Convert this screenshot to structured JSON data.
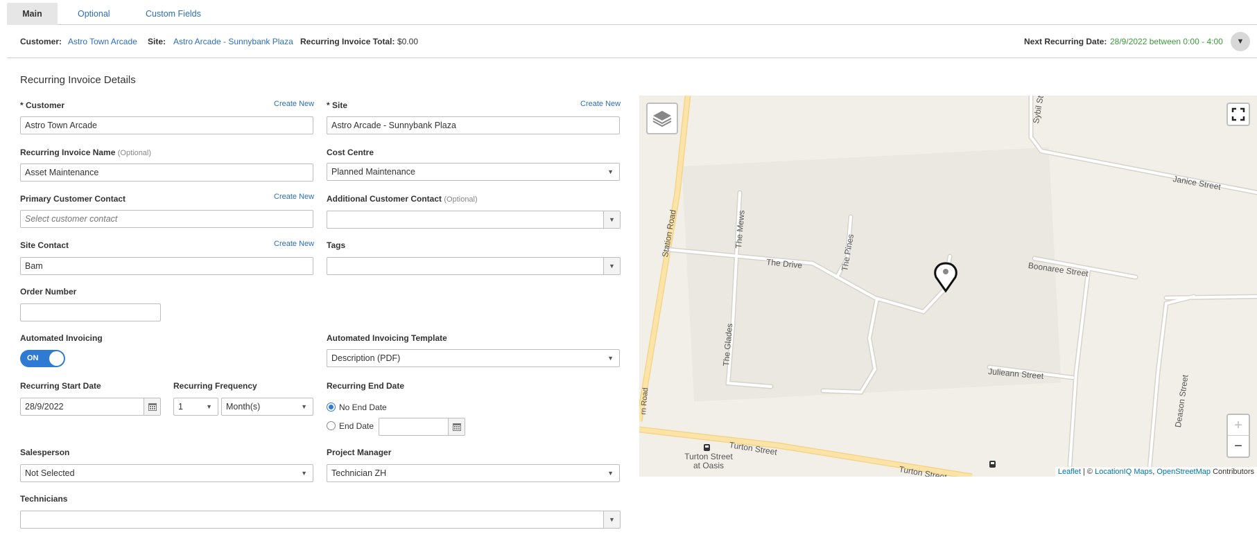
{
  "tabs": [
    "Main",
    "Optional",
    "Custom Fields"
  ],
  "summary": {
    "customer_label": "Customer:",
    "customer_value": "Astro Town Arcade",
    "site_label": "Site:",
    "site_value": "Astro Arcade - Sunnybank Plaza",
    "total_label": "Recurring Invoice Total:",
    "total_value": "$0.00",
    "next_label": "Next Recurring Date:",
    "next_value": "28/9/2022 between 0:00 - 4:00",
    "collapse_icon": "chevron-down-icon"
  },
  "section_title": "Recurring Invoice Details",
  "create_new": "Create New",
  "fields": {
    "customer": {
      "label": "* Customer",
      "value": "Astro Town Arcade"
    },
    "site": {
      "label": "* Site",
      "value": "Astro Arcade - Sunnybank Plaza"
    },
    "invoice_name": {
      "label": "Recurring Invoice Name",
      "optional": "(Optional)",
      "value": "Asset Maintenance"
    },
    "cost_centre": {
      "label": "Cost Centre",
      "value": "Planned Maintenance"
    },
    "primary_contact": {
      "label": "Primary Customer Contact",
      "placeholder": "Select customer contact"
    },
    "additional_contact": {
      "label": "Additional Customer Contact",
      "optional": "(Optional)",
      "value": ""
    },
    "site_contact": {
      "label": "Site Contact",
      "value": "Bam"
    },
    "tags": {
      "label": "Tags",
      "value": ""
    },
    "order_number": {
      "label": "Order Number",
      "value": ""
    },
    "automated_invoicing": {
      "label": "Automated Invoicing",
      "state": "ON"
    },
    "invoicing_template": {
      "label": "Automated Invoicing Template",
      "value": "Description (PDF)"
    },
    "start_date": {
      "label": "Recurring Start Date",
      "value": "28/9/2022"
    },
    "frequency": {
      "label": "Recurring Frequency",
      "count": "1",
      "unit": "Month(s)"
    },
    "end_date": {
      "label": "Recurring End Date",
      "option_none": "No End Date",
      "option_date": "End Date",
      "selected": "No End Date",
      "value": ""
    },
    "salesperson": {
      "label": "Salesperson",
      "value": "Not Selected"
    },
    "project_manager": {
      "label": "Project Manager",
      "value": "Technician ZH"
    },
    "technicians": {
      "label": "Technicians",
      "value": ""
    }
  },
  "map": {
    "streets": [
      "Station Road",
      "The Mews",
      "The Drive",
      "The Pines",
      "The Glades",
      "Sybil St",
      "Janice Street",
      "Boonaree Street",
      "Julieann Street",
      "Deason Street",
      "Turton Street",
      "Turton Street"
    ],
    "marker_label": "Site",
    "bus_stop": "Turton Street at Oasis",
    "zoom_in": "+",
    "zoom_out": "−",
    "attribution_leaflet": "Leaflet",
    "attribution_sep": " | © ",
    "attribution_liq": "LocationIQ Maps",
    "attribution_osm": "OpenStreetMap",
    "attribution_tail": " Contributors",
    "partial_road": "rn Road"
  }
}
